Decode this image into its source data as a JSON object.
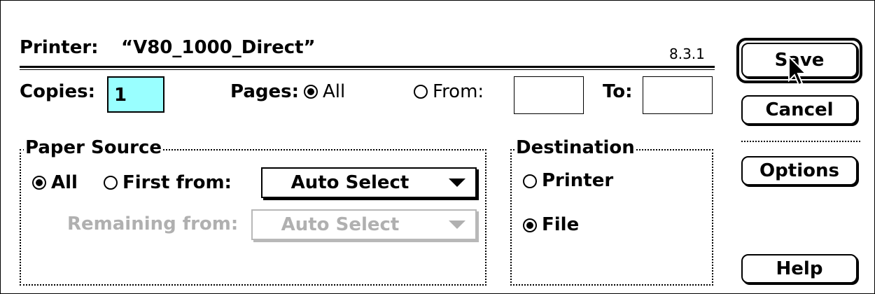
{
  "printer": {
    "label": "Printer:",
    "name": "“V80_1000_Direct”",
    "version": "8.3.1"
  },
  "copies": {
    "label": "Copies:",
    "value": "1"
  },
  "pages": {
    "label": "Pages:",
    "all_label": "All",
    "from_label": "From:",
    "to_label": "To:",
    "from_value": "",
    "to_value": "",
    "selected": "All"
  },
  "paper_source": {
    "title": "Paper Source",
    "all_label": "All",
    "first_from_label": "First from:",
    "first_from_value": "Auto Select",
    "remaining_from_label": "Remaining from:",
    "remaining_from_value": "Auto Select",
    "selected": "All"
  },
  "destination": {
    "title": "Destination",
    "printer_label": "Printer",
    "file_label": "File",
    "selected": "File"
  },
  "buttons": {
    "save": "Save",
    "cancel": "Cancel",
    "options": "Options",
    "help": "Help"
  },
  "colors": {
    "copies_field_bg": "#99ffff",
    "disabled_text": "#b0b0b0"
  },
  "icons": {
    "cursor": "arrow-cursor-icon",
    "popup_arrow": "triangle-down-icon"
  }
}
